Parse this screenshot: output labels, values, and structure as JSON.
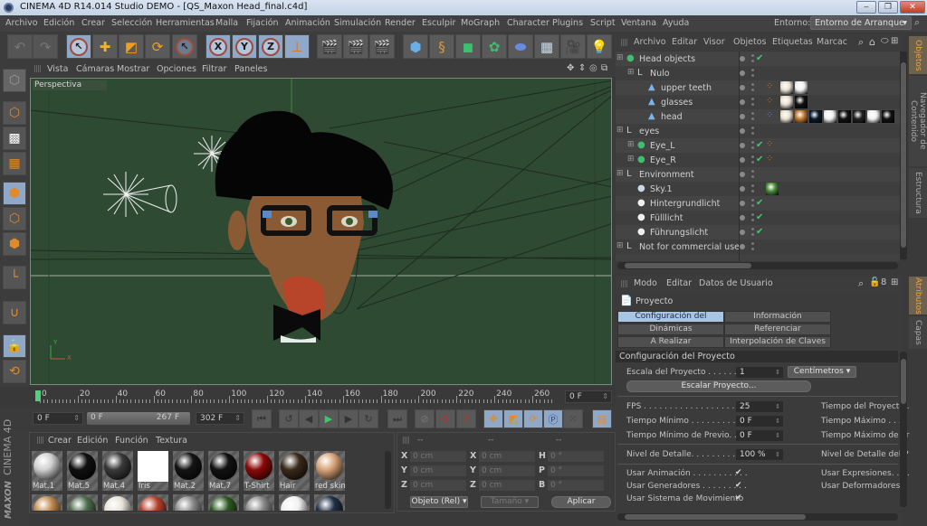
{
  "window": {
    "title": "CINEMA 4D R14.014 Studio DEMO - [QS_Maxon Head_final.c4d]",
    "minimize_label": "‒",
    "restore_label": "❐",
    "close_label": "✕"
  },
  "menubar": {
    "items": [
      "Archivo",
      "Edición",
      "Crear",
      "Selección",
      "Herramientas",
      "Malla",
      "Fijación",
      "Animación",
      "Simulación",
      "Render",
      "Esculpir",
      "MoGraph",
      "Character",
      "Plugins",
      "Script",
      "Ventana",
      "Ayuda"
    ],
    "env_label": "Entorno:",
    "env_value": "Entorno de Arranque"
  },
  "toolbar": {
    "axis_x": "X",
    "axis_y": "Y",
    "axis_z": "Z"
  },
  "viewport": {
    "menu": [
      "Vista",
      "Cámaras",
      "Mostrar",
      "Opciones",
      "Filtrar",
      "Paneles"
    ],
    "label": "Perspectiva",
    "axis_x": "X",
    "axis_y": "Y"
  },
  "timeline": {
    "ticks": [
      "0",
      "20",
      "40",
      "60",
      "80",
      "100",
      "120",
      "140",
      "160",
      "180",
      "200",
      "220",
      "240",
      "260"
    ],
    "current_frame": "0 F",
    "start_frame": "0 F",
    "range_start": "0 F",
    "range_end": "267 F",
    "end_frame": "302 F",
    "playhead_fraction": 0
  },
  "materials": {
    "menu": [
      "Crear",
      "Edición",
      "Función",
      "Textura"
    ],
    "items": [
      {
        "name": "Mat.1",
        "color": "#d0d0d0"
      },
      {
        "name": "Mat.5",
        "color": "#101010"
      },
      {
        "name": "Mat.4",
        "color": "#3a3a3a"
      },
      {
        "name": "Iris",
        "color": "#ffffff"
      },
      {
        "name": "Mat.2",
        "color": "#141414"
      },
      {
        "name": "Mat.7",
        "color": "#121212"
      },
      {
        "name": "T-Shirt",
        "color": "#8c0a0a"
      },
      {
        "name": "Hair",
        "color": "#3a2a1a"
      },
      {
        "name": "red skin",
        "color": "#d9a479"
      }
    ],
    "row2_colors": [
      "#c08a50",
      "#4e6e4e",
      "#e8e2d8",
      "#b4412c",
      "#8a8a8a",
      "#2d5a22",
      "#8a8a8a",
      "#f0f0f0",
      "#1f2f45"
    ]
  },
  "brand": {
    "maxon": "MAXON",
    "cinema": "CINEMA 4D"
  },
  "coords": {
    "headers": [
      "--",
      "--",
      "--"
    ],
    "pos": [
      {
        "axis": "X",
        "value": "0 cm"
      },
      {
        "axis": "Y",
        "value": "0 cm"
      },
      {
        "axis": "Z",
        "value": "0 cm"
      }
    ],
    "size": [
      {
        "axis": "X",
        "value": "0 cm"
      },
      {
        "axis": "Y",
        "value": "0 cm"
      },
      {
        "axis": "Z",
        "value": "0 cm"
      }
    ],
    "rot": [
      {
        "axis": "H",
        "value": "0 °"
      },
      {
        "axis": "P",
        "value": "0 °"
      },
      {
        "axis": "B",
        "value": "0 °"
      }
    ],
    "mode": "Objeto (Rel)",
    "size_mode": "Tamaño",
    "apply": "Aplicar"
  },
  "objects": {
    "menu": [
      "Archivo",
      "Editar",
      "Visor",
      "Objetos",
      "Etiquetas",
      "Marcac"
    ],
    "tree": [
      {
        "name": "Head objects",
        "depth": 0,
        "icon": "green",
        "check": true
      },
      {
        "name": "Nulo",
        "depth": 1,
        "icon": "null",
        "check": false
      },
      {
        "name": "upper teeth",
        "depth": 2,
        "icon": "poly",
        "check": false
      },
      {
        "name": "glasses",
        "depth": 2,
        "icon": "poly",
        "check": false
      },
      {
        "name": "head",
        "depth": 2,
        "icon": "poly",
        "check": false
      },
      {
        "name": "eyes",
        "depth": 0,
        "icon": "null",
        "check": false
      },
      {
        "name": "Eye_L",
        "depth": 1,
        "icon": "green",
        "check": true
      },
      {
        "name": "Eye_R",
        "depth": 1,
        "icon": "green",
        "check": true
      },
      {
        "name": "Environment",
        "depth": 0,
        "icon": "null",
        "check": false
      },
      {
        "name": "Sky.1",
        "depth": 1,
        "icon": "sky",
        "check": false
      },
      {
        "name": "Hintergrundlicht",
        "depth": 1,
        "icon": "light",
        "check": true
      },
      {
        "name": "Fülllicht",
        "depth": 1,
        "icon": "light",
        "check": true
      },
      {
        "name": "Führungslicht",
        "depth": 1,
        "icon": "light",
        "check": true
      },
      {
        "name": "Not for commercial use",
        "depth": 0,
        "icon": "null",
        "check": false
      }
    ]
  },
  "side_tabs": {
    "top": [
      "Objetos",
      "Navegador de Contenido",
      "Estructura"
    ],
    "bottom": [
      "Atributos",
      "Capas"
    ]
  },
  "attributes": {
    "menu": [
      "Modo",
      "Editar",
      "Datos de Usuario"
    ],
    "title": "Proyecto",
    "tabs": [
      "Configuración del Proyecto",
      "Información",
      "Dinámicas",
      "Referenciar",
      "A Realizar",
      "Interpolación de Claves"
    ],
    "section": "Configuración del Proyecto",
    "scale_label": "Escala del Proyecto . . . . . . . .",
    "scale_value": "1",
    "scale_unit": "Centímetros",
    "scale_button": "Escalar Proyecto...",
    "fps_label": "FPS . . . . . . . . . . . . . . . . . .",
    "fps_value": "25",
    "tmin_label": "Tiempo Mínimo . . . . . . . . . .",
    "tmin_value": "0 F",
    "tprev_label": "Tiempo Mínimo de Previo. . .",
    "tprev_value": "0 F",
    "lod_label": "Nivel de Detalle. . . . . . . . . .",
    "lod_value": "100 %",
    "right_labels": [
      "Tiempo del Proyecto .",
      "Tiempo Máximo . . . .",
      "Tiempo Máximo de Pr",
      "Nivel de Detalle del P",
      "Usar Expresiones. . . .",
      "Usar Deformadores. ."
    ],
    "use_anim": "Usar Animación . . . . . . . . . . .",
    "use_gen": "Usar Generadores . . . . . . . . .",
    "use_motion": "Usar Sistema de Movimiento",
    "check": "✔"
  }
}
